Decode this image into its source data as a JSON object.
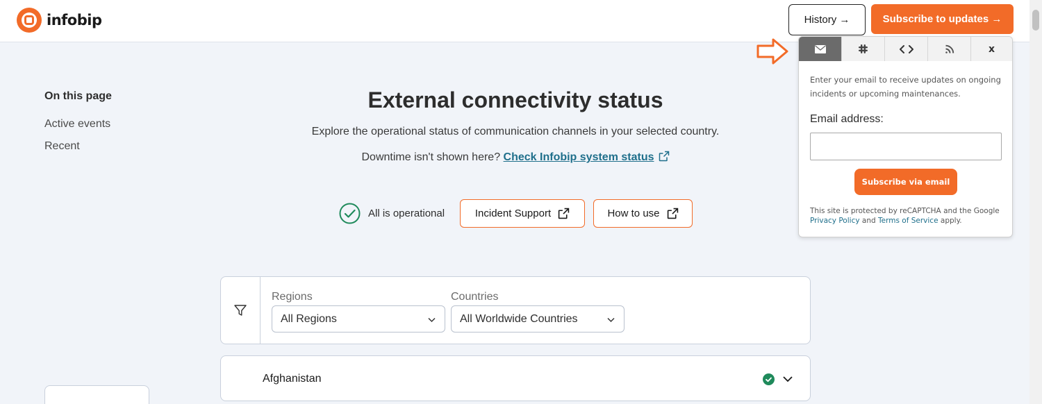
{
  "header": {
    "logo_text": "infobip",
    "history_label": "History →",
    "subscribe_label": "Subscribe to updates →"
  },
  "sidebar": {
    "title": "On this page",
    "items": [
      {
        "label": "Active events"
      },
      {
        "label": "Recent"
      }
    ]
  },
  "main": {
    "title": "External connectivity status",
    "subtitle": "Explore the operational status of communication channels in your selected country.",
    "downtime_text": "Downtime isn't shown here?",
    "downtime_link": "Check Infobip system status",
    "status_label": "All is operational",
    "incident_support_label": "Incident Support",
    "how_to_use_label": "How to use"
  },
  "filters": {
    "regions_label": "Regions",
    "regions_value": "All Regions",
    "countries_label": "Countries",
    "countries_value": "All Worldwide Countries"
  },
  "countries": [
    {
      "name": "Afghanistan",
      "status": "operational"
    }
  ],
  "popup": {
    "tabs": [
      {
        "icon": "envelope-icon",
        "active": true
      },
      {
        "icon": "slack-icon",
        "active": false
      },
      {
        "icon": "code-icon",
        "active": false
      },
      {
        "icon": "rss-icon",
        "active": false
      },
      {
        "icon": "close-icon",
        "label": "x",
        "active": false
      }
    ],
    "description": "Enter your email to receive updates on ongoing incidents or upcoming maintenances.",
    "email_label": "Email address:",
    "email_value": "",
    "email_placeholder": "",
    "submit_label": "Subscribe via email",
    "recaptcha_prefix": "This site is protected by reCAPTCHA and the Google",
    "privacy_link": "Privacy Policy",
    "recaptcha_and": "and",
    "terms_link": "Terms of Service",
    "recaptcha_suffix": "apply."
  },
  "colors": {
    "brand": "#f26b28",
    "success": "#1f8a5b",
    "link": "#1f6f8b",
    "background": "#f1f4f9"
  }
}
